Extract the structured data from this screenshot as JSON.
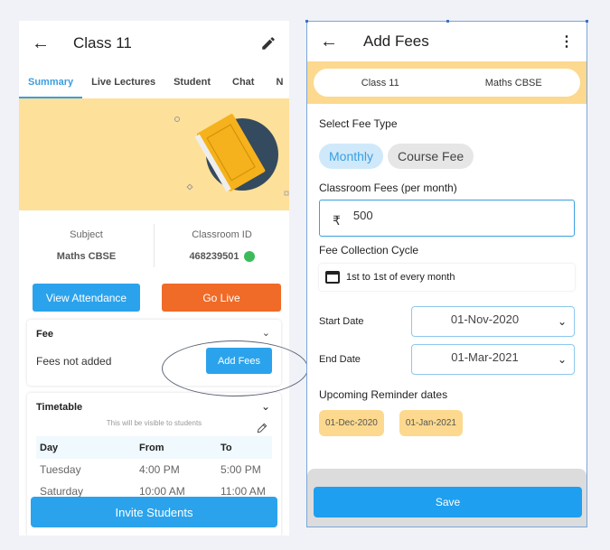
{
  "left": {
    "header": {
      "back_icon": "arrow-left-icon",
      "title": "Class 11",
      "edit_icon": "pencil-icon"
    },
    "tabs": [
      {
        "label": "Summary",
        "active": true
      },
      {
        "label": "Live Lectures",
        "active": false
      },
      {
        "label": "Student",
        "active": false
      },
      {
        "label": "Chat",
        "active": false
      },
      {
        "label": "N",
        "active": false
      }
    ],
    "info": {
      "subject_label": "Subject",
      "subject_value": "Maths CBSE",
      "classroom_label": "Classroom ID",
      "classroom_value": "468239501",
      "share_icon": "whatsapp-icon"
    },
    "buttons": {
      "attendance": "View Attendance",
      "go_live": "Go Live"
    },
    "fee": {
      "title": "Fee",
      "status": "Fees not added",
      "add_button": "Add Fees"
    },
    "timetable": {
      "title": "Timetable",
      "subtitle": "This will be visible to students",
      "headers": [
        "Day",
        "From",
        "To"
      ],
      "rows": [
        [
          "Tuesday",
          "4:00 PM",
          "5:00 PM"
        ],
        [
          "Saturday",
          "10:00 AM",
          "11:00 AM"
        ]
      ]
    },
    "invite_button": "Invite Students"
  },
  "right": {
    "header": {
      "back_icon": "arrow-left-icon",
      "title": "Add Fees",
      "more_icon": "more-vertical-icon"
    },
    "context": {
      "class": "Class 11",
      "subject": "Maths CBSE"
    },
    "fee_type": {
      "label": "Select Fee Type",
      "options": [
        "Monthly",
        "Course Fee"
      ],
      "selected": "Monthly"
    },
    "classroom_fees": {
      "label": "Classroom Fees (per month)",
      "currency": "₹",
      "value": "500"
    },
    "collection_cycle": {
      "label": "Fee Collection Cycle",
      "value": "1st to 1st of every month"
    },
    "start_date": {
      "label": "Start Date",
      "value": "01-Nov-2020"
    },
    "end_date": {
      "label": "End Date",
      "value": "01-Mar-2021"
    },
    "reminders": {
      "label": "Upcoming Reminder dates",
      "dates": [
        "01-Dec-2020",
        "01-Jan-2021"
      ]
    },
    "save_button": "Save"
  },
  "colors": {
    "primary": "#2ba3ec",
    "live": "#f06a28",
    "banner": "#fde09a",
    "reminder": "#fcd98e"
  }
}
